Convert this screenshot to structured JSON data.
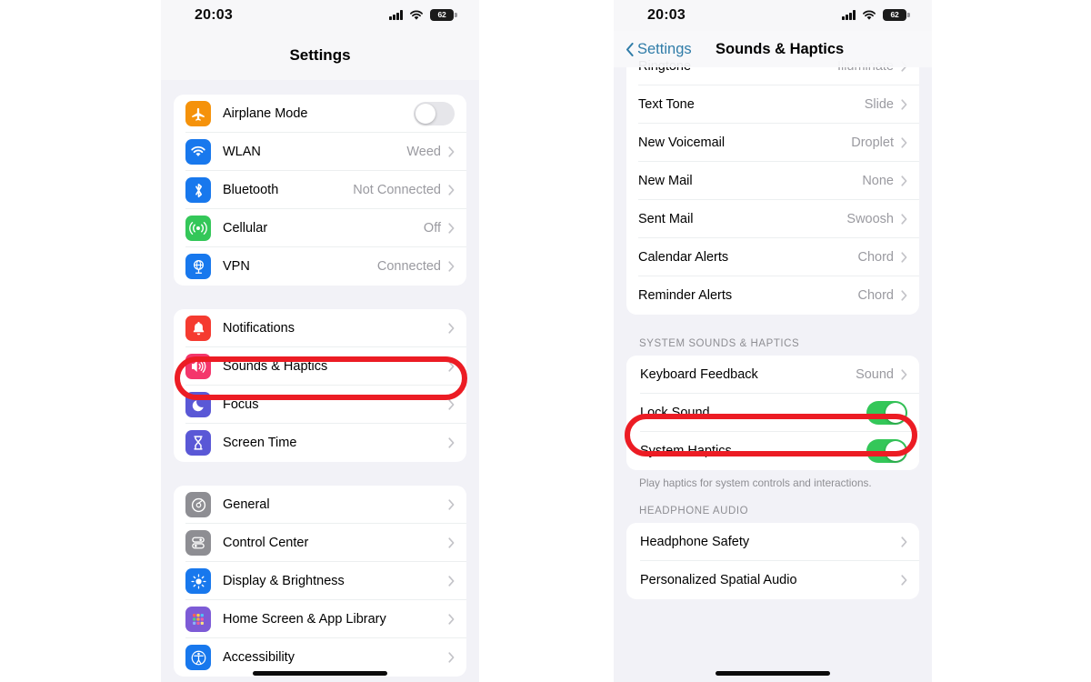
{
  "status_bar": {
    "time": "20:03",
    "battery_percent": "62",
    "cellular_icon": "cellular-bars-icon",
    "wifi_icon": "wifi-icon",
    "battery_icon": "battery-icon"
  },
  "left_phone": {
    "nav": {
      "title": "Settings"
    },
    "groups": [
      {
        "name": "connectivity",
        "rows": [
          {
            "icon": "airplane-icon",
            "icon_color": "#f5920b",
            "label": "Airplane Mode",
            "control": "toggle",
            "toggle_on": false
          },
          {
            "icon": "wifi-icon",
            "icon_color": "#1878ed",
            "label": "WLAN",
            "value": "Weed",
            "control": "chevron"
          },
          {
            "icon": "bluetooth-icon",
            "icon_color": "#1878ed",
            "label": "Bluetooth",
            "value": "Not Connected",
            "control": "chevron"
          },
          {
            "icon": "cellular-icon",
            "icon_color": "#34c759",
            "label": "Cellular",
            "value": "Off",
            "control": "chevron"
          },
          {
            "icon": "vpn-globe-icon",
            "icon_color": "#1878ed",
            "label": "VPN",
            "value": "Connected",
            "control": "chevron"
          }
        ]
      },
      {
        "name": "alerts",
        "rows": [
          {
            "icon": "bell-icon",
            "icon_color": "#f53b30",
            "label": "Notifications",
            "control": "chevron"
          },
          {
            "icon": "speaker-icon",
            "icon_color": "#f4366b",
            "label": "Sounds & Haptics",
            "control": "chevron",
            "highlighted": true
          },
          {
            "icon": "moon-icon",
            "icon_color": "#5a58d6",
            "label": "Focus",
            "control": "chevron"
          },
          {
            "icon": "hourglass-icon",
            "icon_color": "#5a58d6",
            "label": "Screen Time",
            "control": "chevron"
          }
        ]
      },
      {
        "name": "system",
        "rows": [
          {
            "icon": "gear-icon",
            "icon_color": "#8e8e93",
            "label": "General",
            "control": "chevron"
          },
          {
            "icon": "sliders-icon",
            "icon_color": "#8e8e93",
            "label": "Control Center",
            "control": "chevron"
          },
          {
            "icon": "brightness-icon",
            "icon_color": "#1878ed",
            "label": "Display & Brightness",
            "control": "chevron"
          },
          {
            "icon": "app-grid-icon",
            "icon_color": "#7d5bd6",
            "label": "Home Screen & App Library",
            "control": "chevron"
          },
          {
            "icon": "accessibility-icon",
            "icon_color": "#1878ed",
            "label": "Accessibility",
            "control": "chevron"
          }
        ]
      }
    ]
  },
  "right_phone": {
    "nav": {
      "back_label": "Settings",
      "title": "Sounds & Haptics"
    },
    "sounds_group": {
      "rows": [
        {
          "label": "Ringtone",
          "value": "Illuminate",
          "control": "chevron",
          "clipped": true
        },
        {
          "label": "Text Tone",
          "value": "Slide",
          "control": "chevron"
        },
        {
          "label": "New Voicemail",
          "value": "Droplet",
          "control": "chevron"
        },
        {
          "label": "New Mail",
          "value": "None",
          "control": "chevron"
        },
        {
          "label": "Sent Mail",
          "value": "Swoosh",
          "control": "chevron"
        },
        {
          "label": "Calendar Alerts",
          "value": "Chord",
          "control": "chevron"
        },
        {
          "label": "Reminder Alerts",
          "value": "Chord",
          "control": "chevron"
        }
      ]
    },
    "system_sounds_section": {
      "header": "SYSTEM SOUNDS & HAPTICS",
      "footer": "Play haptics for system controls and interactions.",
      "rows": [
        {
          "label": "Keyboard Feedback",
          "value": "Sound",
          "control": "chevron"
        },
        {
          "label": "Lock Sound",
          "control": "toggle",
          "toggle_on": true,
          "highlighted": true
        },
        {
          "label": "System Haptics",
          "control": "toggle",
          "toggle_on": true
        }
      ]
    },
    "headphone_section": {
      "header": "HEADPHONE AUDIO",
      "rows": [
        {
          "label": "Headphone Safety",
          "control": "chevron"
        },
        {
          "label": "Personalized Spatial Audio",
          "control": "chevron"
        }
      ]
    }
  },
  "annotations": {
    "highlight_color": "#ec1c24",
    "toggle_on_color": "#34c759",
    "toggle_off_color": "#e6e6ea",
    "link_color": "#2f7ca8"
  }
}
